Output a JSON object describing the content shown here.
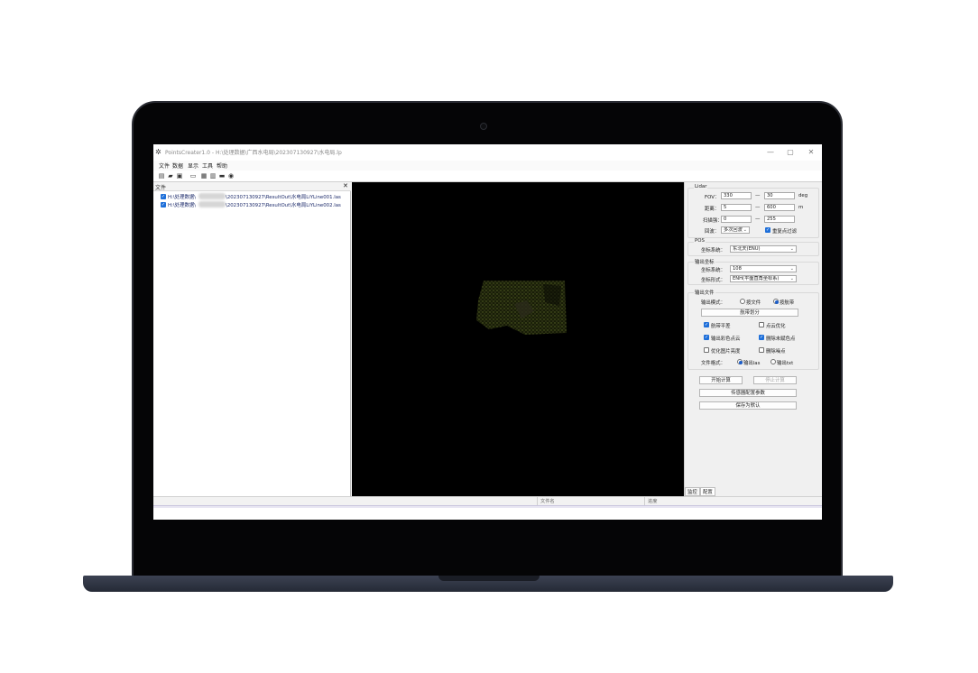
{
  "window": {
    "title": "PointsCreater1.0 - H:\\处理数据\\广西水电局\\202307130927\\水电局.lp",
    "app_icon": "gear-icon",
    "controls": {
      "minimize": "—",
      "maximize": "▢",
      "close": "✕"
    }
  },
  "menu": [
    "文件",
    "数据",
    "显示",
    "工具",
    "帮助"
  ],
  "toolbar_icons": [
    "new-file-icon",
    "open-folder-icon",
    "save-icon",
    "print-icon",
    "open-icon",
    "table-icon",
    "monitor-icon",
    "eye-settings-icon",
    "chat-icon"
  ],
  "file_panel": {
    "title": "文件",
    "close": "✕",
    "files": [
      {
        "prefix": "H:\\处理数据\\",
        "suffix": "\\202307130927\\ResultOut\\水电局LiYLine001.las",
        "checked": true
      },
      {
        "prefix": "H:\\处理数据\\",
        "suffix": "\\202307130927\\ResultOut\\水电局LiYLine002.las",
        "checked": true
      }
    ]
  },
  "lidar": {
    "group_label": "Lidar",
    "fov_label": "FOV：",
    "fov_min": "330",
    "fov_max": "30",
    "fov_unit": "deg",
    "dist_label": "距离：",
    "dist_min": "5",
    "dist_max": "600",
    "dist_unit": "m",
    "scan_label": "扫描强：",
    "scan_min": "0",
    "scan_max": "255",
    "echo_label": "回波：",
    "echo_value": "多次回波",
    "repeat_filter_label": "重复点过滤",
    "repeat_filter_checked": true,
    "dash": "—"
  },
  "pos": {
    "group_label": "POS",
    "coord_label": "坐标系统：",
    "coord_value": "东北天(ENU)"
  },
  "output_coord": {
    "group_label": "输出坐标",
    "coord_label": "坐标系统：",
    "coord_value": "108",
    "form_label": "坐标形式：",
    "form_value": "ENH(平面直角坐标系)"
  },
  "output_file": {
    "group_label": "输出文件",
    "mode_label": "输出模式：",
    "mode_options": [
      {
        "label": "按文件",
        "selected": false
      },
      {
        "label": "按航带",
        "selected": true
      }
    ],
    "split_button": "航带划分",
    "options": [
      {
        "label": "航带平差",
        "checked": true
      },
      {
        "label": "点云优化",
        "checked": false
      },
      {
        "label": "输出彩色点云",
        "checked": true
      },
      {
        "label": "删除未赋色点",
        "checked": true
      },
      {
        "label": "优化图片亮度",
        "checked": false
      },
      {
        "label": "删除噪点",
        "checked": false
      }
    ],
    "format_label": "文件格式：",
    "format_options": [
      {
        "label": "输出las",
        "selected": true
      },
      {
        "label": "输出txt",
        "selected": false
      }
    ]
  },
  "actions": {
    "start": "开始计算",
    "stop": "停止计算",
    "sensor_config": "传感器配置参数",
    "save_default": "保存为默认"
  },
  "tabs": [
    "监控",
    "配置"
  ],
  "statusbar": {
    "file_name": "文件名",
    "progress": "进度"
  },
  "colors": {
    "accent": "#1e6fd9",
    "viewport": "#000000",
    "pointcloud": "#5a6a2a"
  }
}
